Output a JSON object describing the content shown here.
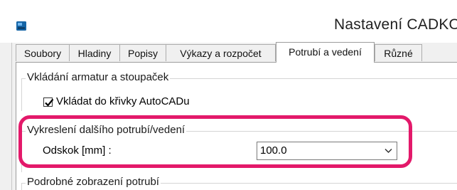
{
  "window": {
    "title": "Nastavení CADKO",
    "icon": "app-window-icon"
  },
  "tabs": [
    {
      "label": "Soubory",
      "active": false
    },
    {
      "label": "Hladiny",
      "active": false
    },
    {
      "label": "Popisy",
      "active": false
    },
    {
      "label": "Výkazy a rozpočet",
      "active": false
    },
    {
      "label": "Potrubí a vedení",
      "active": true
    },
    {
      "label": "Různé",
      "active": false
    }
  ],
  "groups": {
    "fittings": {
      "title": "Vkládání armatur a stoupaček",
      "checkbox_label": "Vkládat do křivky AutoCADu",
      "checkbox_checked": true
    },
    "drawing": {
      "title": "Vykreslení dalšího potrubí/vedení",
      "offset_label": "Odskok [mm] :",
      "offset_value": "100.0"
    },
    "detail": {
      "title": "Podrobné zobrazení potrubí"
    }
  },
  "colors": {
    "highlight": "#e3196a",
    "panel_bg": "#ffffff",
    "window_bg": "#f0f0f0"
  }
}
